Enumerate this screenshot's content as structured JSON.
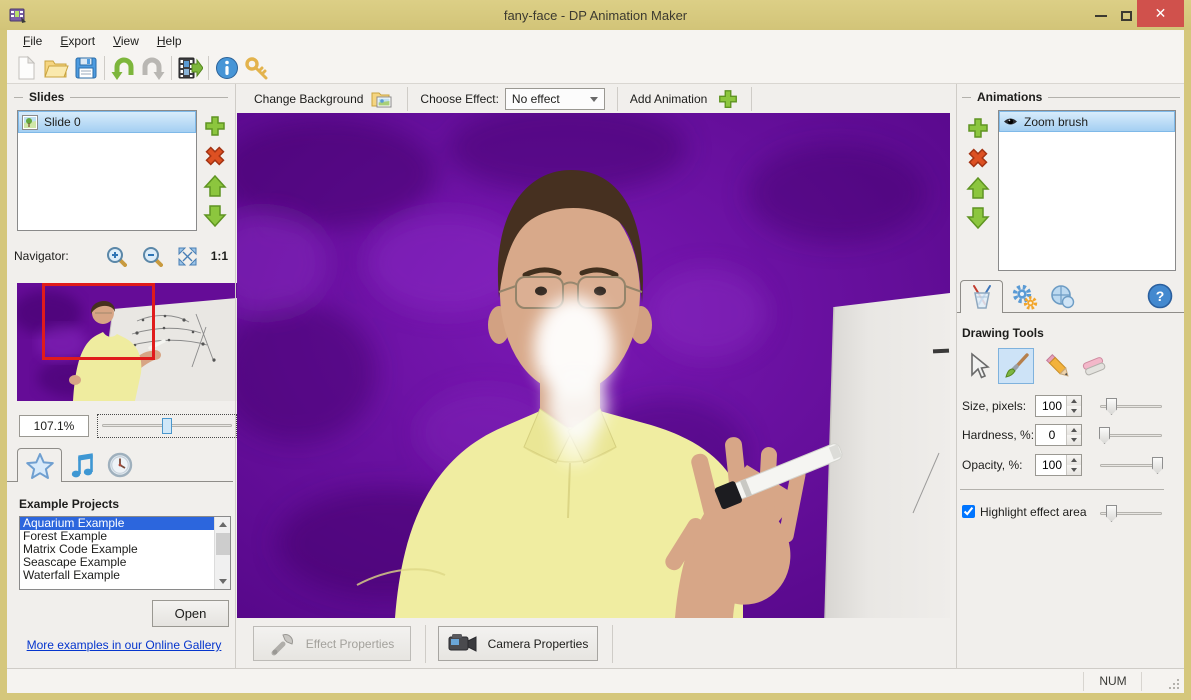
{
  "window": {
    "title": "fany-face - DP Animation Maker"
  },
  "menu": {
    "items": [
      {
        "key": "F",
        "rest": "ile"
      },
      {
        "key": "E",
        "rest": "xport"
      },
      {
        "key": "V",
        "rest": "iew"
      },
      {
        "key": "H",
        "rest": "elp"
      }
    ]
  },
  "canvas_toolbar": {
    "change_background_label": "Change Background",
    "choose_effect_label": "Choose Effect:",
    "effect_selected": "No effect",
    "add_animation_label": "Add Animation"
  },
  "slides_panel": {
    "title": "Slides",
    "items": [
      {
        "label": "Slide 0"
      }
    ],
    "navigator_label": "Navigator:",
    "actual_size": "1:1",
    "zoom_value": "107.1%"
  },
  "example_projects": {
    "title": "Example Projects",
    "items": [
      "Aquarium Example",
      "Forest Example",
      "Matrix Code Example",
      "Seascape Example",
      "Waterfall Example"
    ],
    "open_button_label": "Open",
    "gallery_link_label": "More examples in our Online Gallery"
  },
  "animations_panel": {
    "title": "Animations",
    "items": [
      {
        "label": "Zoom brush"
      }
    ]
  },
  "drawing_tools": {
    "title": "Drawing Tools",
    "size_label": "Size, pixels:",
    "size_value": "100",
    "hardness_label": "Hardness, %:",
    "hardness_value": "0",
    "opacity_label": "Opacity, %:",
    "opacity_value": "100",
    "highlight_label": "Highlight effect area",
    "highlight_checked": "checked"
  },
  "bottom_bar": {
    "effect_properties_label": "Effect Properties",
    "camera_properties_label": "Camera Properties"
  },
  "status_bar": {
    "num_indicator": "NUM"
  },
  "colors": {
    "frame": "#d5c77c",
    "close_button": "#d0514c",
    "selection_blue": "#2c66dd",
    "accent_green": "#8cc63e",
    "canvas_purple": "#650c97"
  }
}
